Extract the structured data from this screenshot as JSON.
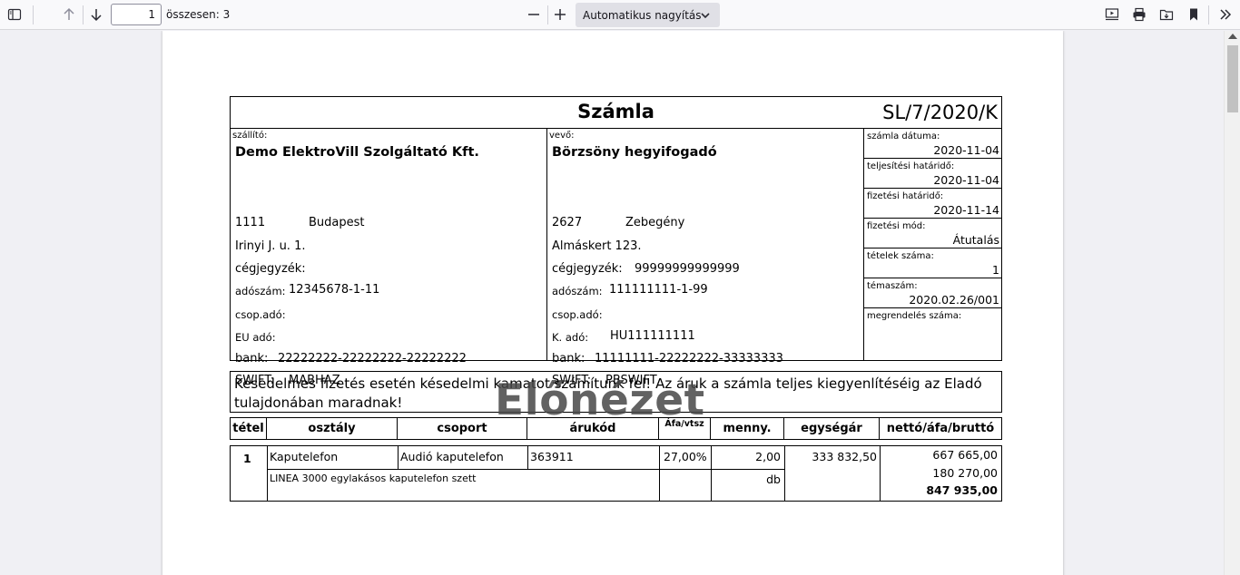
{
  "toolbar": {
    "page_number": "1",
    "page_total": "összesen: 3",
    "zoom": "Automatikus nagyítás",
    "icons": [
      "sidebar-toggle-icon",
      "arrow-up-icon",
      "arrow-down-icon",
      "minus-icon",
      "plus-icon",
      "presentation-icon",
      "print-icon",
      "save-icon",
      "bookmark-icon",
      "double-chevron-right-icon"
    ]
  },
  "invoice": {
    "title": "Számla",
    "number": "SL/7/2020/K",
    "seller": {
      "label": "szállító:",
      "name": "Demo ElektroVill Szolgáltató Kft.",
      "zip": "1111",
      "city": "Budapest",
      "street": "Irinyi J. u. 1.",
      "reg_label": "cégjegyzék:",
      "reg_value": "",
      "tax_label": "adószám:",
      "tax_value": "12345678-1-11",
      "group_tax_label": "csop.adó:",
      "group_tax_value": "",
      "eu_label": "EU adó:",
      "eu_value": "",
      "bank_label": "bank:",
      "bank_value": "22222222-22222222-22222222",
      "swift_label": "SWIFT:",
      "swift_value": "MABHAZ"
    },
    "buyer": {
      "label": "vevő:",
      "name": "Börzsöny hegyifogadó",
      "zip": "2627",
      "city": "Zebegény",
      "street": "Almáskert 123.",
      "reg_label": "cégjegyzék:",
      "reg_value": "99999999999999",
      "tax_label": "adószám:",
      "tax_value": "111111111-1-99",
      "group_tax_label": "csop.adó:",
      "group_tax_value": "",
      "k_label": "K. adó:",
      "k_value": "HU111111111",
      "bank_label": "bank:",
      "bank_value": "11111111-22222222-33333333",
      "swift_label": "SWIFT:",
      "swift_value": "PBSWIFT"
    },
    "meta": [
      {
        "label": "számla dátuma:",
        "value": "2020-11-04"
      },
      {
        "label": "teljesítési határidő:",
        "value": "2020-11-04"
      },
      {
        "label": "fizetési határidő:",
        "value": "2020-11-14"
      },
      {
        "label": "fizetési mód:",
        "value": "Átutalás"
      },
      {
        "label": "tételek száma:",
        "value": "1"
      },
      {
        "label": "témaszám:",
        "value": "2020.02.26/001"
      },
      {
        "label": "megrendelés száma:",
        "value": ""
      }
    ],
    "notice": "Késedelmes fizetés esetén késedelmi kamatot számítunk fel! Az áruk a számla teljes kiegyenlítéséig az Eladó tulajdonában maradnak!",
    "watermark": "Előnézet",
    "columns": [
      "tétel",
      "osztály",
      "csoport",
      "árukód",
      "Áfa/vtsz",
      "menny.",
      "egységár",
      "nettó/áfa/bruttó"
    ],
    "rows": [
      {
        "item": "1",
        "class": "Kaputelefon",
        "group": "Audió kaputelefon",
        "code": "363911",
        "vat": "27,00%",
        "qty": "2,00",
        "unit": "db",
        "unit_price": "333 832,50",
        "net": "667 665,00",
        "vat_amount": "180 270,00",
        "gross": "847 935,00",
        "description": "LINEA 3000 egylakásos kaputelefon szett"
      }
    ]
  }
}
